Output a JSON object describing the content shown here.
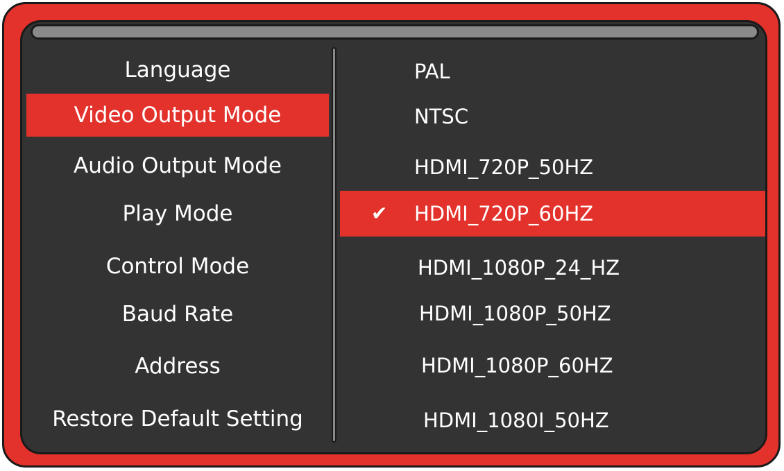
{
  "colors": {
    "accent": "#e3312b",
    "panel": "#333333",
    "outline": "#1a1a1a",
    "scrollbar": "#8a8a8a",
    "text": "#ffffff"
  },
  "menu": {
    "items": [
      {
        "label": "Language"
      },
      {
        "label": "Video Output Mode",
        "selected": true
      },
      {
        "label": "Audio Output Mode"
      },
      {
        "label": "Play Mode"
      },
      {
        "label": "Control Mode"
      },
      {
        "label": "Baud Rate"
      },
      {
        "label": "Address"
      },
      {
        "label": "Restore Default Setting"
      }
    ]
  },
  "options": {
    "items": [
      {
        "label": "PAL"
      },
      {
        "label": "NTSC"
      },
      {
        "label": "HDMI_720P_50HZ"
      },
      {
        "label": "HDMI_720P_60HZ",
        "selected": true,
        "checked": true
      },
      {
        "label": "HDMI_1080P_24_HZ"
      },
      {
        "label": "HDMI_1080P_50HZ"
      },
      {
        "label": "HDMI_1080P_60HZ"
      },
      {
        "label": "HDMI_1080I_50HZ"
      }
    ],
    "check_mark": "✔"
  }
}
